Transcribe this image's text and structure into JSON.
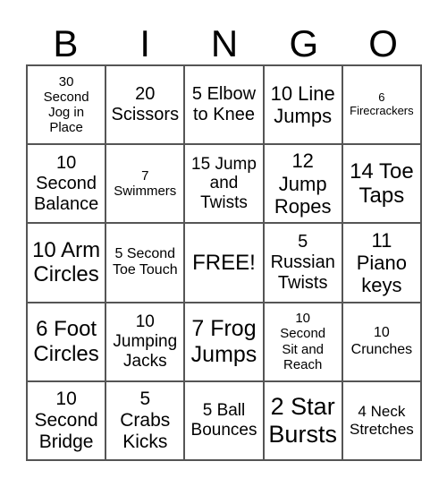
{
  "header": {
    "letters": [
      "B",
      "I",
      "N",
      "G",
      "O"
    ]
  },
  "cells": [
    "30\nSecond\nJog in\nPlace",
    "20\nScissors",
    "5 Elbow\nto Knee",
    "10 Line\nJumps",
    "6\nFirecrackers",
    "10\nSecond\nBalance",
    "7\nSwimmers",
    "15 Jump\nand\nTwists",
    "12\nJump\nRopes",
    "14 Toe\nTaps",
    "10 Arm\nCircles",
    "5 Second\nToe Touch",
    "FREE!",
    "5\nRussian\nTwists",
    "11\nPiano\nkeys",
    "6 Foot\nCircles",
    "10\nJumping\nJacks",
    "7 Frog\nJumps",
    "10\nSecond\nSit and\nReach",
    "10\nCrunches",
    "10\nSecond\nBridge",
    "5\nCrabs\nKicks",
    "5 Ball\nBounces",
    "2 Star\nBursts",
    "4 Neck\nStretches"
  ]
}
